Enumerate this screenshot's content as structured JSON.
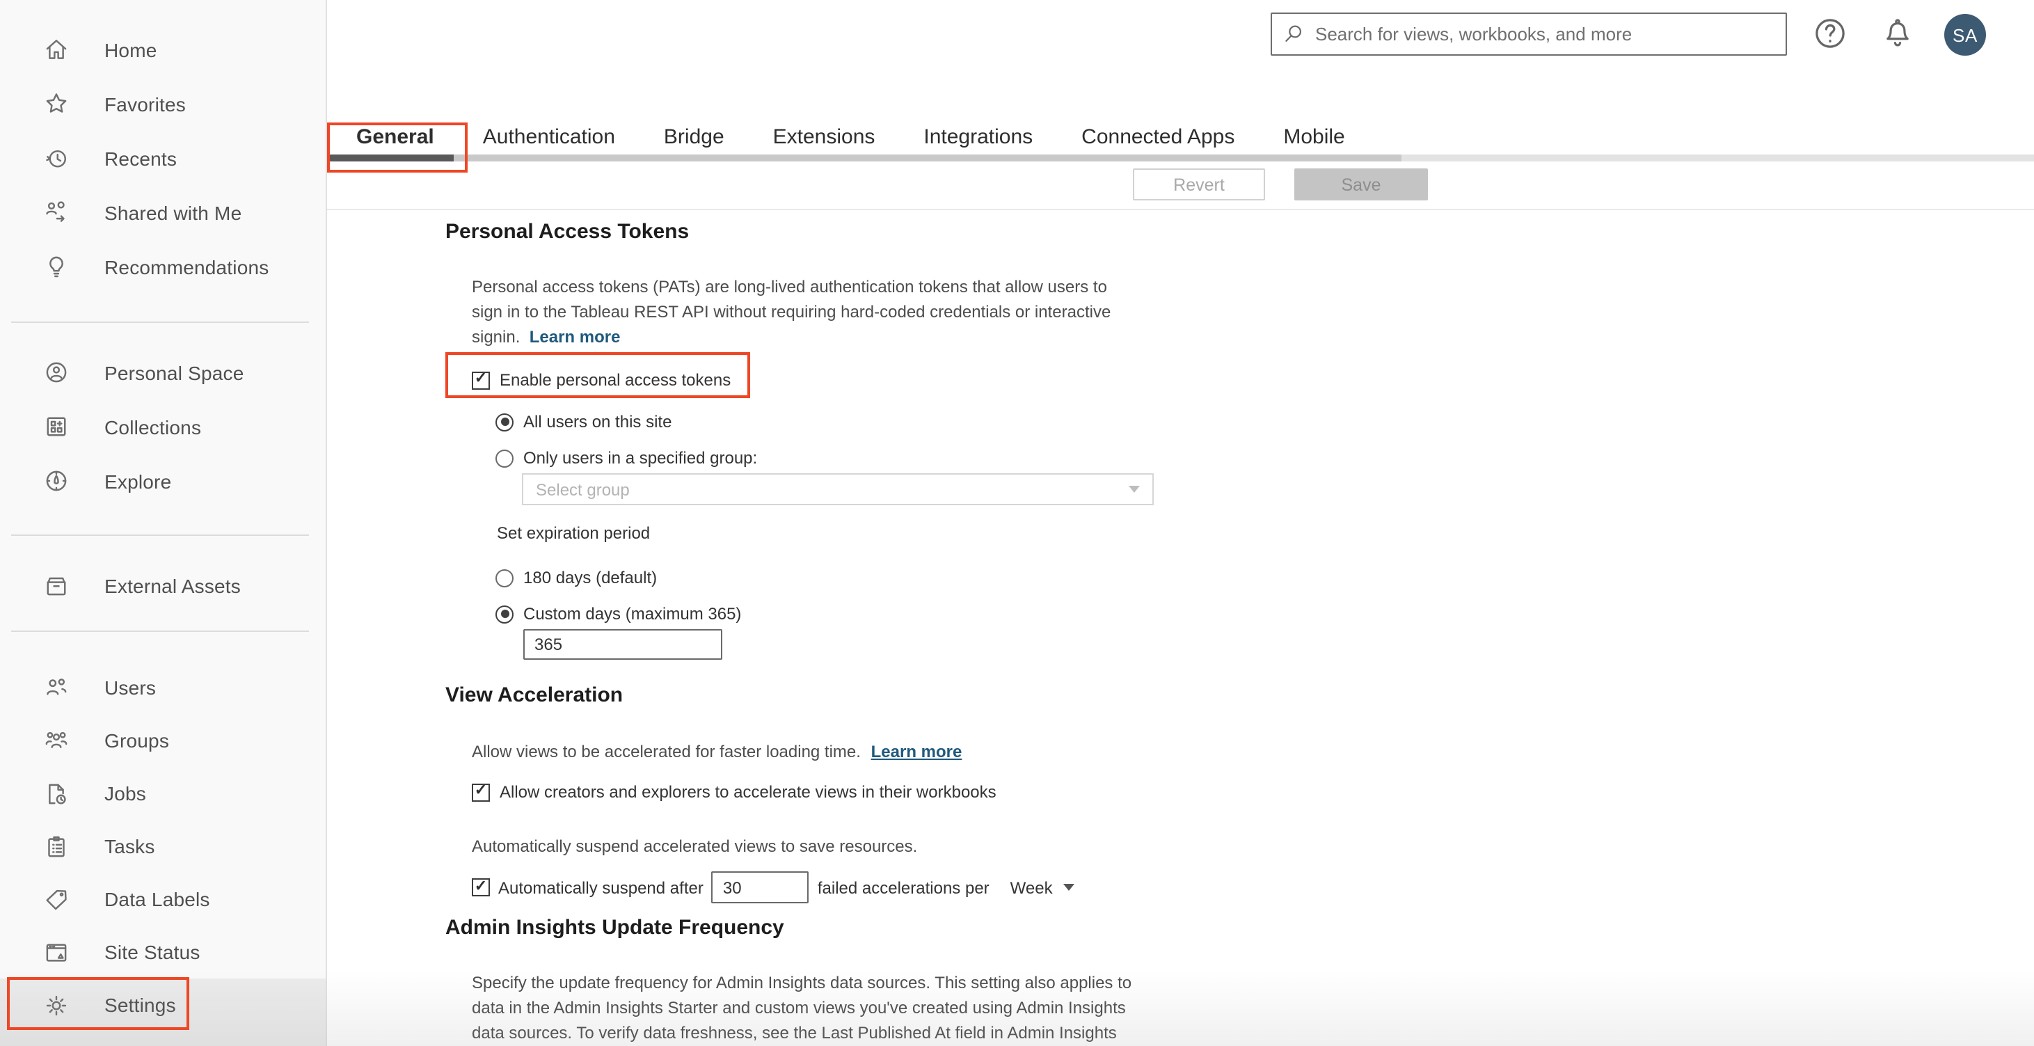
{
  "header": {
    "search_placeholder": "Search for views, workbooks, and more",
    "avatar_initials": "SA"
  },
  "sidebar": {
    "groups": [
      {
        "items": [
          {
            "label": "Home",
            "icon": "home-icon"
          },
          {
            "label": "Favorites",
            "icon": "star-icon"
          },
          {
            "label": "Recents",
            "icon": "clock-history-icon"
          },
          {
            "label": "Shared with Me",
            "icon": "shared-people-icon"
          },
          {
            "label": "Recommendations",
            "icon": "lightbulb-icon"
          }
        ]
      },
      {
        "items": [
          {
            "label": "Personal Space",
            "icon": "person-circle-icon"
          },
          {
            "label": "Collections",
            "icon": "collections-grid-icon"
          },
          {
            "label": "Explore",
            "icon": "compass-icon"
          }
        ]
      },
      {
        "items": [
          {
            "label": "External Assets",
            "icon": "archive-box-icon"
          }
        ]
      },
      {
        "items": [
          {
            "label": "Users",
            "icon": "users-icon"
          },
          {
            "label": "Groups",
            "icon": "groups-icon"
          },
          {
            "label": "Jobs",
            "icon": "document-clock-icon"
          },
          {
            "label": "Tasks",
            "icon": "clipboard-list-icon"
          },
          {
            "label": "Data Labels",
            "icon": "tag-icon"
          },
          {
            "label": "Site Status",
            "icon": "browser-status-icon"
          },
          {
            "label": "Settings",
            "icon": "gear-icon"
          }
        ]
      }
    ],
    "selected": "Settings"
  },
  "tabs": {
    "items": [
      "General",
      "Authentication",
      "Bridge",
      "Extensions",
      "Integrations",
      "Connected Apps",
      "Mobile"
    ],
    "active": "General"
  },
  "toolbar": {
    "revert_label": "Revert",
    "save_label": "Save"
  },
  "sections": {
    "pat": {
      "heading": "Personal Access Tokens",
      "description_lines": [
        "Personal access tokens (PATs) are long-lived authentication tokens that allow users to",
        "sign in to the Tableau REST API without requiring hard-coded credentials or interactive",
        "signin."
      ],
      "learn_more": "Learn more",
      "enable_label": "Enable personal access tokens",
      "enable_checked": true,
      "radio_all_users": "All users on this site",
      "radio_all_users_selected": true,
      "radio_specified_group": "Only users in a specified group:",
      "radio_specified_group_selected": false,
      "group_select_placeholder": "Select group",
      "expiration_label": "Set expiration period",
      "radio_180": "180 days (default)",
      "radio_180_selected": false,
      "radio_custom": "Custom days (maximum 365)",
      "radio_custom_selected": true,
      "custom_days_value": "365"
    },
    "va": {
      "heading": "View Acceleration",
      "description": "Allow views to be accelerated for faster loading time.",
      "learn_more": "Learn more",
      "allow_label": "Allow creators and explorers to accelerate views in their workbooks",
      "allow_checked": true,
      "suspend_intro": "Automatically suspend accelerated views to save resources.",
      "suspend_prefix": "Automatically suspend after",
      "suspend_value": "30",
      "suspend_suffix": "failed accelerations per",
      "suspend_checked": true,
      "period_value": "Week"
    },
    "ai": {
      "heading": "Admin Insights Update Frequency",
      "description_lines": [
        "Specify the update frequency for Admin Insights data sources. This setting also applies to",
        "data in the Admin Insights Starter and custom views you've created using Admin Insights",
        "data sources. To verify data freshness, see the Last Published At field in Admin Insights"
      ]
    }
  },
  "colors": {
    "annotation_red": "#ee4726",
    "link_blue": "#20597c",
    "avatar_bg": "#3d5a73",
    "tab_indicator": "#595959"
  }
}
